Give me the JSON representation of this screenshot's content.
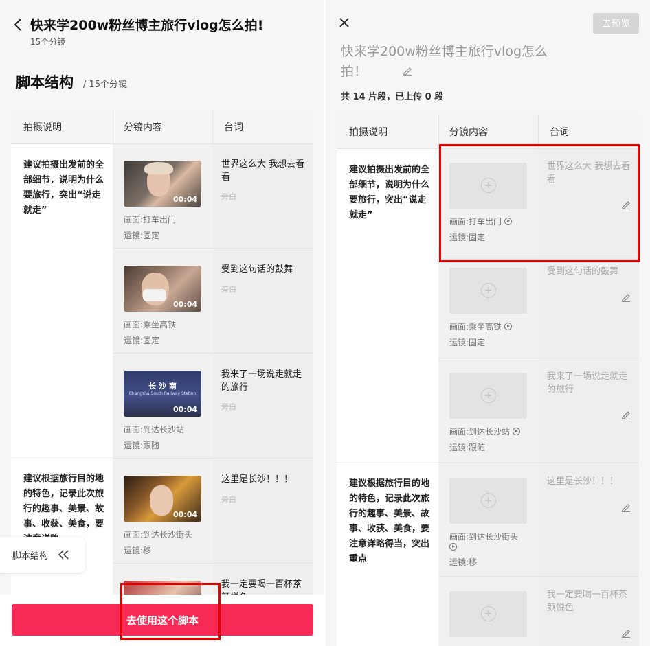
{
  "colors": {
    "accent": "#f62a55",
    "highlight": "#e60000"
  },
  "left": {
    "title": "快来学200w粉丝博主旅行vlog怎么拍!",
    "subtitle": "15个分镜",
    "section_title": "脚本结构",
    "section_sub": "/ 15个分镜",
    "headers": [
      "拍摄说明",
      "分镜内容",
      "台词"
    ],
    "groups": [
      {
        "desc": "建议拍摄出发前的全部细节，说明为什么要旅行，突出“说走就走”"
      },
      {
        "desc": "建议根据旅行目的地的特色，记录此次旅行的趣事、美景、故事、收获、美食，要注意详略"
      }
    ],
    "shots": [
      {
        "duration": "00:04",
        "scene": "画面:打车出门",
        "move": "运镜:固定",
        "line": "世界这么大 我想去看看",
        "voice": "旁白"
      },
      {
        "duration": "00:04",
        "scene": "画面:乘坐高铁",
        "move": "运镜:固定",
        "line": "受到这句话的鼓舞",
        "voice": "旁白"
      },
      {
        "duration": "00:04",
        "scene": "画面:到达长沙站",
        "move": "运镜:跟随",
        "line": "我来了一场说走就走的旅行",
        "voice": "旁白"
      },
      {
        "duration": "00:04",
        "scene": "画面:到达长沙街头",
        "move": "运镜:移",
        "line": "这里是长沙！！！",
        "voice": "旁白"
      },
      {
        "line": "我一定要喝一百杯茶颜悦色"
      }
    ],
    "station_sign": "长 沙 南",
    "station_sign_en": "Changsha South Railway Station",
    "chip_label": "脚本结构",
    "cta": "去使用这个脚本"
  },
  "right": {
    "preview_button": "去预览",
    "title": "快来学200w粉丝博主旅行vlog怎么拍！",
    "count": "共 14 片段，已上传 0 段",
    "headers": [
      "拍摄说明",
      "分镜内容",
      "台词"
    ],
    "groups": [
      {
        "desc": "建议拍摄出发前的全部细节，说明为什么要旅行，突出“说走就走”"
      },
      {
        "desc": "建议根据旅行目的地的特色，记录此次旅行的趣事、美景、故事、收获、美食，要注意详略得当，突出重点"
      }
    ],
    "shots": [
      {
        "scene": "画面:打车出门",
        "move": "运镜:固定",
        "line": "世界这么大 我想去看看"
      },
      {
        "scene": "画面:乘坐高铁",
        "move": "运镜:固定",
        "line": "受到这句话的鼓舞"
      },
      {
        "scene": "画面:到达长沙站",
        "move": "运镜:跟随",
        "line": "我来了一场说走就走的旅行"
      },
      {
        "scene": "画面:到达长沙街头",
        "move": "运镜:移",
        "line": "这里是长沙！！！"
      },
      {
        "line": "我一定要喝一百杯茶颜悦色"
      }
    ]
  }
}
